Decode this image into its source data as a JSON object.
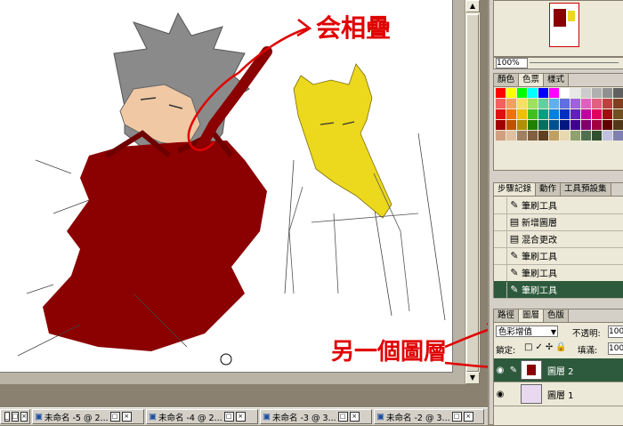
{
  "navigator": {
    "zoom": "100%"
  },
  "swatches_panel": {
    "tabs": [
      "顏色",
      "色票",
      "樣式"
    ],
    "colors": [
      "#ff0000",
      "#ffff00",
      "#00ff00",
      "#00ffff",
      "#0000ff",
      "#ff00ff",
      "#ffffff",
      "#e8e8e8",
      "#cccccc",
      "#b0b0b0",
      "#909090",
      "#606060",
      "#000000",
      "#f26060",
      "#f2a060",
      "#f6e060",
      "#a0e060",
      "#60d0a0",
      "#60b0f0",
      "#6070e0",
      "#a060e0",
      "#e060c0",
      "#e06080",
      "#c04040",
      "#804020",
      "#402010",
      "#e01010",
      "#f07010",
      "#f0c000",
      "#40c020",
      "#00a080",
      "#0080e0",
      "#0030c0",
      "#6020c0",
      "#c000a0",
      "#e00060",
      "#a01010",
      "#705020",
      "#203010",
      "#a00000",
      "#c05000",
      "#b09000",
      "#208000",
      "#007060",
      "#005090",
      "#001880",
      "#400090",
      "#800070",
      "#a00040",
      "#600000",
      "#503818",
      "#102000",
      "#d0a080",
      "#e0c0a0",
      "#a08060",
      "#806040",
      "#604020",
      "#c0a060",
      "#e8d8b0",
      "#90a070",
      "#507050",
      "#305030",
      "#c0c0e0",
      "#8080b0",
      "#404070"
    ]
  },
  "history_panel": {
    "tabs": [
      "步驟記錄",
      "動作",
      "工具預設集"
    ],
    "items": [
      {
        "icon": "brush-icon",
        "label": "筆刷工具",
        "selected": false
      },
      {
        "icon": "document-icon",
        "label": "新增圖層",
        "selected": false
      },
      {
        "icon": "document-icon",
        "label": "混合更改",
        "selected": false
      },
      {
        "icon": "brush-icon",
        "label": "筆刷工具",
        "selected": false
      },
      {
        "icon": "brush-icon",
        "label": "筆刷工具",
        "selected": false
      },
      {
        "icon": "brush-icon",
        "label": "筆刷工具",
        "selected": true
      }
    ]
  },
  "layers_panel": {
    "tabs": [
      "路徑",
      "圖層",
      "色版"
    ],
    "blend_mode": "色彩增值",
    "opacity_label": "不透明:",
    "opacity_value": "100",
    "lock_label": "鎖定:",
    "fill_label": "填滿:",
    "fill_value": "100",
    "layers": [
      {
        "name": "圖層 2",
        "selected": true
      },
      {
        "name": "圖層 1",
        "selected": false
      }
    ]
  },
  "annotations": {
    "top": "会相疊",
    "layer": "另一個圖層"
  },
  "taskbar": {
    "tasks": [
      "未命名 -5 @ 2...",
      "未命名 -4 @ 2...",
      "未命名 -3 @ 3...",
      "未命名 -2 @ 3..."
    ]
  },
  "colors": {
    "accent_red": "#e00000",
    "robe": "#8b0000",
    "cat_yellow": "#ecd81c",
    "selected_row": "#2d5a3c"
  }
}
